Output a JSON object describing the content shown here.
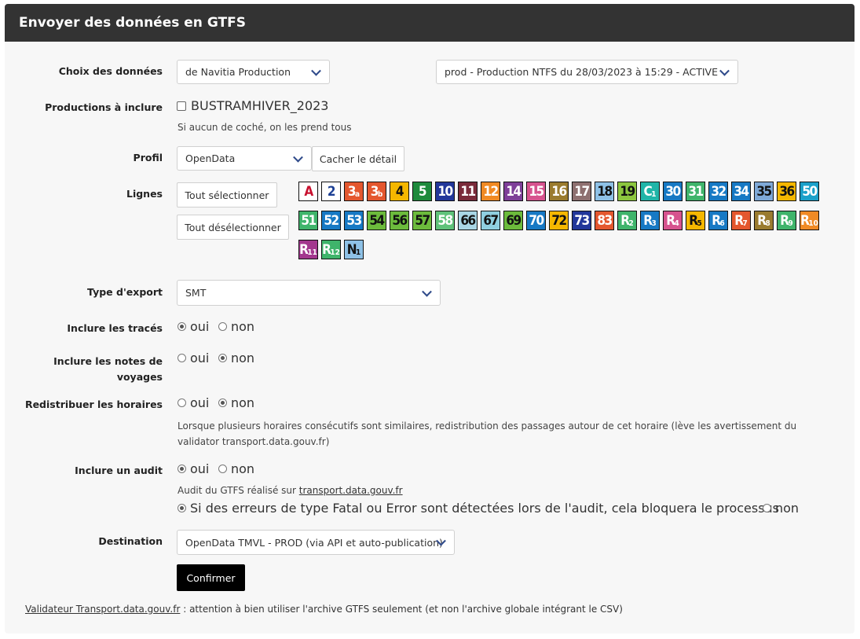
{
  "header": {
    "title": "Envoyer des données en GTFS"
  },
  "form": {
    "choix_label": "Choix des données",
    "source_select": "de Navitia Production",
    "production_select": "prod - Production NTFS du 28/03/2023 à 15:29 - ACTIVE",
    "productions_label": "Productions à inclure",
    "production_checkbox": "BUSTRAMHIVER_2023",
    "productions_help": "Si aucun de coché, on les prend tous",
    "profil_label": "Profil",
    "profil_select": "OpenData",
    "hide_detail_button": "Cacher le détail",
    "lignes_label": "Lignes",
    "select_all_button": "Tout sélectionner",
    "deselect_all_button": "Tout désélectionner",
    "lines": [
      {
        "main": "A",
        "sub": "",
        "bg": "#ffffff",
        "fg": "#c8102e"
      },
      {
        "main": "2",
        "sub": "",
        "bg": "#ffffff",
        "fg": "#1c3f94"
      },
      {
        "main": "3",
        "sub": "a",
        "bg": "#e4572e",
        "fg": "#ffffff"
      },
      {
        "main": "3",
        "sub": "b",
        "bg": "#e4572e",
        "fg": "#ffffff"
      },
      {
        "main": "4",
        "sub": "",
        "bg": "#f5b700",
        "fg": "#111111"
      },
      {
        "main": "5",
        "sub": "",
        "bg": "#1e8a3c",
        "fg": "#ffffff"
      },
      {
        "main": "10",
        "sub": "",
        "bg": "#22379a",
        "fg": "#ffffff"
      },
      {
        "main": "11",
        "sub": "",
        "bg": "#7a2b3a",
        "fg": "#ffffff"
      },
      {
        "main": "12",
        "sub": "",
        "bg": "#f08a24",
        "fg": "#ffffff"
      },
      {
        "main": "14",
        "sub": "",
        "bg": "#7e3f98",
        "fg": "#ffffff"
      },
      {
        "main": "15",
        "sub": "",
        "bg": "#d6538e",
        "fg": "#ffffff"
      },
      {
        "main": "16",
        "sub": "",
        "bg": "#9a7b2f",
        "fg": "#ffffff"
      },
      {
        "main": "17",
        "sub": "",
        "bg": "#8e7070",
        "fg": "#ffffff"
      },
      {
        "main": "18",
        "sub": "",
        "bg": "#8ec1e6",
        "fg": "#111111"
      },
      {
        "main": "19",
        "sub": "",
        "bg": "#8cc63f",
        "fg": "#111111"
      },
      {
        "main": "C",
        "sub": "1",
        "bg": "#20b5a8",
        "fg": "#ffffff"
      },
      {
        "main": "30",
        "sub": "",
        "bg": "#1779c4",
        "fg": "#ffffff"
      },
      {
        "main": "31",
        "sub": "",
        "bg": "#3fb46b",
        "fg": "#ffffff"
      },
      {
        "main": "32",
        "sub": "",
        "bg": "#1779c4",
        "fg": "#ffffff"
      },
      {
        "main": "34",
        "sub": "",
        "bg": "#1779c4",
        "fg": "#ffffff"
      },
      {
        "main": "35",
        "sub": "",
        "bg": "#7fa9d8",
        "fg": "#111111"
      },
      {
        "main": "36",
        "sub": "",
        "bg": "#f5b700",
        "fg": "#111111"
      },
      {
        "main": "50",
        "sub": "",
        "bg": "#1aa0c9",
        "fg": "#ffffff"
      },
      {
        "main": "51",
        "sub": "",
        "bg": "#3fb46b",
        "fg": "#ffffff"
      },
      {
        "main": "52",
        "sub": "",
        "bg": "#1779c4",
        "fg": "#ffffff"
      },
      {
        "main": "53",
        "sub": "",
        "bg": "#1779c4",
        "fg": "#ffffff"
      },
      {
        "main": "54",
        "sub": "",
        "bg": "#6cbb3c",
        "fg": "#111111"
      },
      {
        "main": "56",
        "sub": "",
        "bg": "#6cbb3c",
        "fg": "#111111"
      },
      {
        "main": "57",
        "sub": "",
        "bg": "#6cbb3c",
        "fg": "#111111"
      },
      {
        "main": "58",
        "sub": "",
        "bg": "#5fc27a",
        "fg": "#ffffff"
      },
      {
        "main": "66",
        "sub": "",
        "bg": "#a9d6e5",
        "fg": "#111111"
      },
      {
        "main": "67",
        "sub": "",
        "bg": "#8fcfe0",
        "fg": "#111111"
      },
      {
        "main": "69",
        "sub": "",
        "bg": "#6cbb3c",
        "fg": "#111111"
      },
      {
        "main": "70",
        "sub": "",
        "bg": "#1779c4",
        "fg": "#ffffff"
      },
      {
        "main": "72",
        "sub": "",
        "bg": "#f5b700",
        "fg": "#111111"
      },
      {
        "main": "73",
        "sub": "",
        "bg": "#22379a",
        "fg": "#ffffff"
      },
      {
        "main": "83",
        "sub": "",
        "bg": "#e4572e",
        "fg": "#ffffff"
      },
      {
        "main": "R",
        "sub": "2",
        "bg": "#3fb46b",
        "fg": "#ffffff"
      },
      {
        "main": "R",
        "sub": "3",
        "bg": "#1779c4",
        "fg": "#ffffff"
      },
      {
        "main": "R",
        "sub": "4",
        "bg": "#d6538e",
        "fg": "#ffffff"
      },
      {
        "main": "R",
        "sub": "5",
        "bg": "#f5b700",
        "fg": "#111111"
      },
      {
        "main": "R",
        "sub": "6",
        "bg": "#1779c4",
        "fg": "#ffffff"
      },
      {
        "main": "R",
        "sub": "7",
        "bg": "#e4572e",
        "fg": "#ffffff"
      },
      {
        "main": "R",
        "sub": "8",
        "bg": "#9a7b2f",
        "fg": "#ffffff"
      },
      {
        "main": "R",
        "sub": "9",
        "bg": "#3fb46b",
        "fg": "#ffffff"
      },
      {
        "main": "R",
        "sub": "10",
        "bg": "#f08a24",
        "fg": "#ffffff"
      },
      {
        "main": "R",
        "sub": "11",
        "bg": "#a3378e",
        "fg": "#ffffff"
      },
      {
        "main": "R",
        "sub": "12",
        "bg": "#3fb46b",
        "fg": "#ffffff"
      },
      {
        "main": "N",
        "sub": "1",
        "bg": "#8ec1e6",
        "fg": "#111111"
      }
    ],
    "export_label": "Type d'export",
    "export_select": "SMT",
    "traces_label": "Inclure les tracés",
    "notes_label": "Inclure les notes de voyages",
    "redistribuer_label": "Redistribuer les horaires",
    "redistribuer_help": "Lorsque plusieurs horaires consécutifs sont similaires, redistribution des passages autour de cet horaire (lève les avertissement du validator transport.data.gouv.fr)",
    "audit_label": "Inclure un audit",
    "audit_help_prefix": "Audit du GTFS réalisé sur ",
    "audit_help_link": "transport.data.gouv.fr",
    "audit_block_option": "Si des erreurs de type Fatal ou Error sont détectées lors de l'audit, cela bloquera le processus",
    "oui": "oui",
    "non": "non",
    "destination_label": "Destination",
    "destination_select": "OpenData TMVL - PROD (via API et auto-publication)",
    "confirm_button": "Confirmer"
  },
  "footer": {
    "link": "Validateur Transport.data.gouv.fr",
    "text": " : attention à bien utiliser l'archive GTFS seulement (et non l'archive globale intégrant le CSV)"
  },
  "state": {
    "traces": "oui",
    "notes": "non",
    "redistribuer": "non",
    "audit": "oui",
    "audit_block": "yes"
  }
}
